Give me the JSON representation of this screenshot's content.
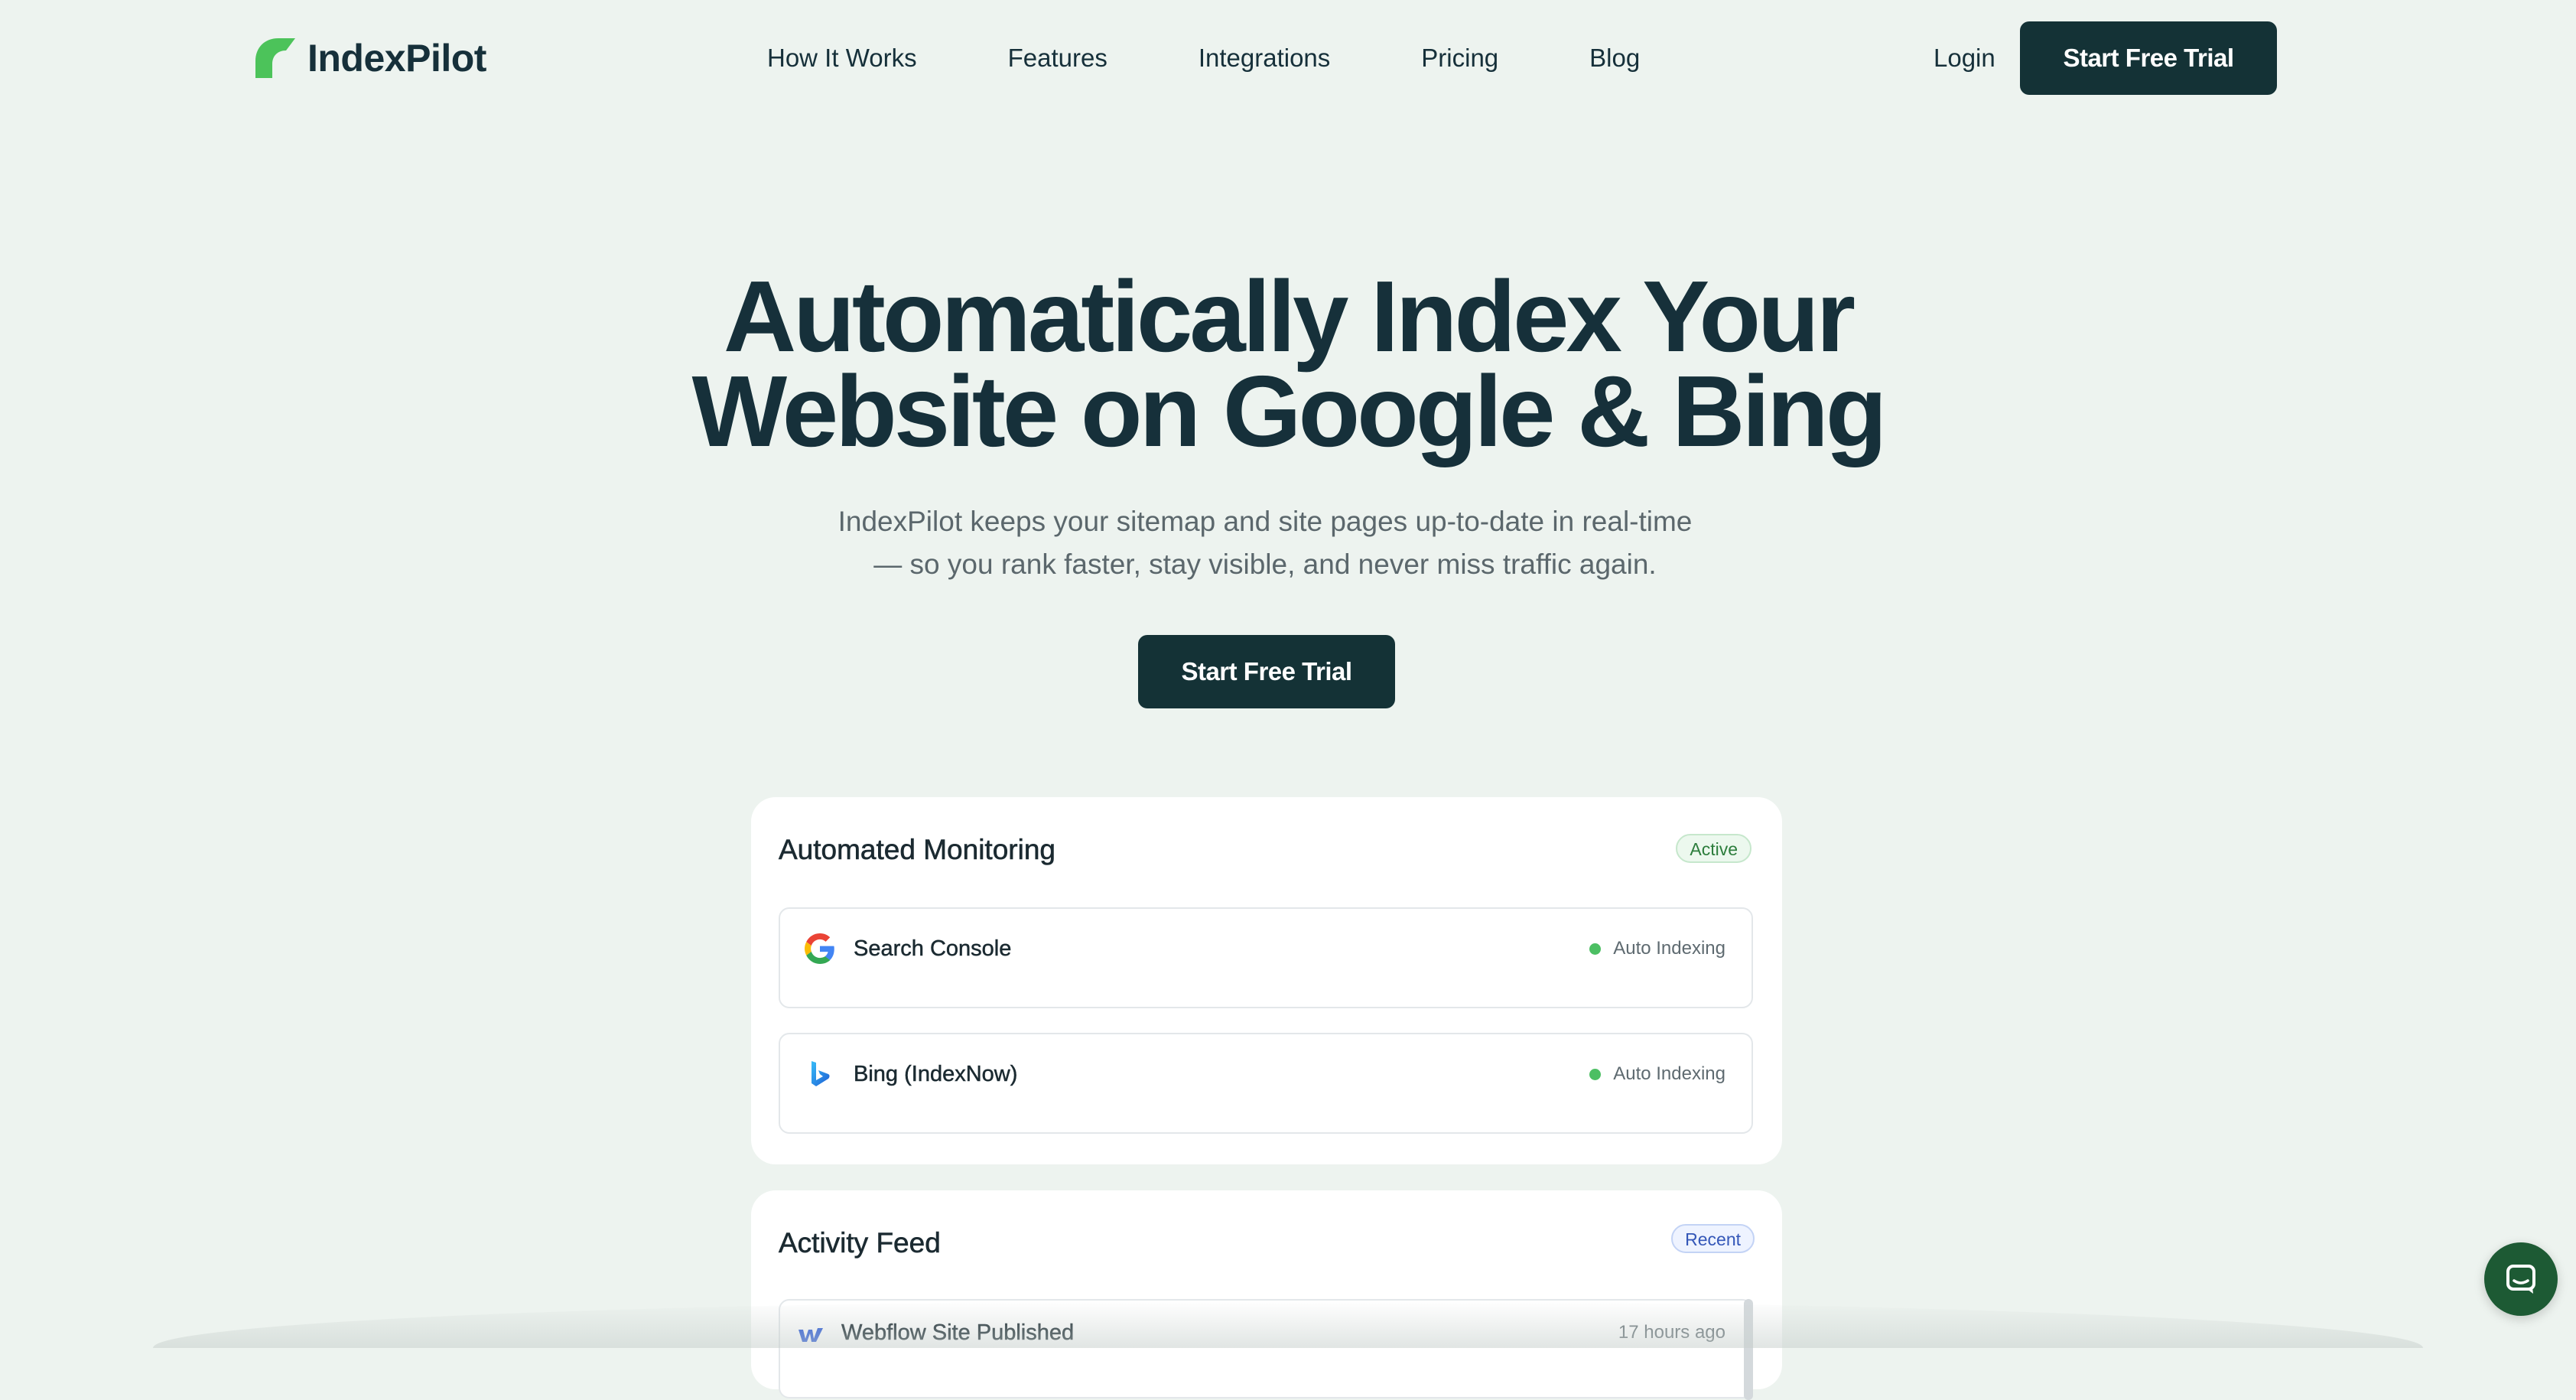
{
  "header": {
    "logo_text": "IndexPilot",
    "nav": [
      "How It Works",
      "Features",
      "Integrations",
      "Pricing",
      "Blog"
    ],
    "login_label": "Login",
    "cta_label": "Start Free Trial"
  },
  "hero": {
    "title_line1": "Automatically Index Your",
    "title_line2": "Website on Google & Bing",
    "subtitle_line1": "IndexPilot keeps your sitemap and site pages up-to-date in real-time",
    "subtitle_line2": "— so you rank faster, stay visible, and never miss traffic again.",
    "cta_label": "Start Free Trial"
  },
  "monitoring": {
    "title": "Automated Monitoring",
    "badge": "Active",
    "integrations": [
      {
        "name": "Search Console",
        "status": "Auto Indexing",
        "icon": "google-icon"
      },
      {
        "name": "Bing (IndexNow)",
        "status": "Auto Indexing",
        "icon": "bing-icon"
      }
    ]
  },
  "activity": {
    "title": "Activity Feed",
    "badge": "Recent",
    "items": [
      {
        "label": "Webflow Site Published",
        "time": "17 hours ago",
        "icon": "webflow-icon"
      }
    ]
  },
  "colors": {
    "background": "#edf3ef",
    "primary": "#143236",
    "accent_green": "#4cbf63",
    "chat": "#1d5a34"
  }
}
